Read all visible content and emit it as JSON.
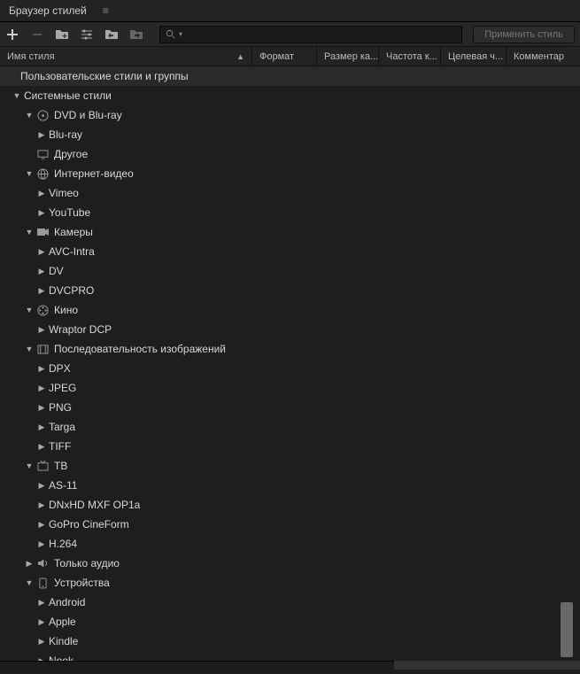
{
  "titlebar": {
    "title": "Браузер стилей",
    "menu_icon": "≡"
  },
  "toolbar": {
    "apply_label": "Применить стиль"
  },
  "headers": {
    "name": "Имя стиля",
    "format": "Формат",
    "size": "Размер ка...",
    "rate": "Частота к...",
    "target": "Целевая ч...",
    "comment": "Комментар"
  },
  "tree": {
    "user_group": "Пользовательские стили и группы",
    "system_group": "Системные стили",
    "items": [
      {
        "label": "DVD и Blu-ray",
        "icon": "disc",
        "depth": 2,
        "arrow": "down"
      },
      {
        "label": "Blu-ray",
        "icon": "",
        "depth": 3,
        "arrow": "right"
      },
      {
        "label": "Другое",
        "icon": "monitor",
        "depth": 2,
        "arrow": "blank"
      },
      {
        "label": "Интернет-видео",
        "icon": "globe",
        "depth": 2,
        "arrow": "down"
      },
      {
        "label": "Vimeo",
        "icon": "",
        "depth": 3,
        "arrow": "right"
      },
      {
        "label": "YouTube",
        "icon": "",
        "depth": 3,
        "arrow": "right"
      },
      {
        "label": "Камеры",
        "icon": "camera",
        "depth": 2,
        "arrow": "down"
      },
      {
        "label": "AVC-Intra",
        "icon": "",
        "depth": 3,
        "arrow": "right"
      },
      {
        "label": "DV",
        "icon": "",
        "depth": 3,
        "arrow": "right"
      },
      {
        "label": "DVCPRO",
        "icon": "",
        "depth": 3,
        "arrow": "right"
      },
      {
        "label": "Кино",
        "icon": "film",
        "depth": 2,
        "arrow": "down"
      },
      {
        "label": "Wraptor DCP",
        "icon": "",
        "depth": 3,
        "arrow": "right"
      },
      {
        "label": "Последовательность изображений",
        "icon": "frames",
        "depth": 2,
        "arrow": "down"
      },
      {
        "label": "DPX",
        "icon": "",
        "depth": 3,
        "arrow": "right"
      },
      {
        "label": "JPEG",
        "icon": "",
        "depth": 3,
        "arrow": "right"
      },
      {
        "label": "PNG",
        "icon": "",
        "depth": 3,
        "arrow": "right"
      },
      {
        "label": "Targa",
        "icon": "",
        "depth": 3,
        "arrow": "right"
      },
      {
        "label": "TIFF",
        "icon": "",
        "depth": 3,
        "arrow": "right"
      },
      {
        "label": "ТВ",
        "icon": "tv",
        "depth": 2,
        "arrow": "down"
      },
      {
        "label": "AS-11",
        "icon": "",
        "depth": 3,
        "arrow": "right"
      },
      {
        "label": "DNxHD MXF OP1a",
        "icon": "",
        "depth": 3,
        "arrow": "right"
      },
      {
        "label": "GoPro CineForm",
        "icon": "",
        "depth": 3,
        "arrow": "right"
      },
      {
        "label": "H.264",
        "icon": "",
        "depth": 3,
        "arrow": "right"
      },
      {
        "label": "Только аудио",
        "icon": "speaker",
        "depth": 2,
        "arrow": "right"
      },
      {
        "label": "Устройства",
        "icon": "device",
        "depth": 2,
        "arrow": "down"
      },
      {
        "label": "Android",
        "icon": "",
        "depth": 3,
        "arrow": "right"
      },
      {
        "label": "Apple",
        "icon": "",
        "depth": 3,
        "arrow": "right"
      },
      {
        "label": "Kindle",
        "icon": "",
        "depth": 3,
        "arrow": "right"
      },
      {
        "label": "Nook",
        "icon": "",
        "depth": 3,
        "arrow": "right"
      }
    ]
  }
}
